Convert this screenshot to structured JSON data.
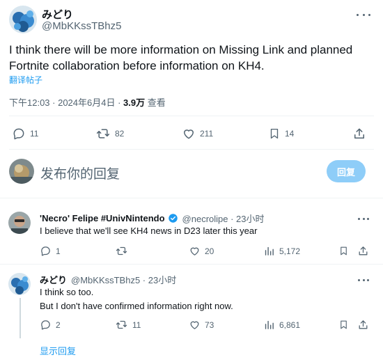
{
  "main_post": {
    "author_name": "みどり",
    "author_handle": "@MbKKssTBhz5",
    "text": "I think there will be more information on Missing Link and planned Fortnite collaboration before information on KH4.",
    "translate_label": "翻译帖子",
    "timestamp": "下午12:03 · 2024年6月4日 · ",
    "views_count": "3.9万",
    "views_label": " 查看",
    "stats": {
      "replies": "11",
      "reposts": "82",
      "likes": "211",
      "bookmarks": "14"
    }
  },
  "composer": {
    "placeholder": "发布你的回复",
    "reply_button": "回复"
  },
  "replies": [
    {
      "author_name": "'Necro' Felipe #UnivNintendo",
      "author_handle": "@necrolipe · 23小时",
      "text_lines": [
        "I believe that we'll see KH4 news in D23 later this year"
      ],
      "stats": {
        "replies": "1",
        "reposts": "",
        "likes": "20",
        "views": "5,172"
      }
    },
    {
      "author_name": "みどり",
      "author_handle": "@MbKKssTBhz5 · 23小时",
      "text_lines": [
        "I think so too.",
        "But I don't have confirmed information right now."
      ],
      "stats": {
        "replies": "2",
        "reposts": "11",
        "likes": "73",
        "views": "6,861"
      }
    }
  ],
  "show_replies_label": "显示回复",
  "colors": {
    "accent": "#1d9bf0",
    "reply_button_disabled": "#8ecdf8",
    "muted_text": "#536471",
    "verified_badge": "#1d9bf0"
  },
  "icons": {
    "reply": "reply-icon",
    "repost": "repost-icon",
    "like": "heart-icon",
    "bookmark": "bookmark-icon",
    "share": "share-icon",
    "views": "views-icon",
    "more": "more-icon",
    "verified": "verified-badge-icon"
  }
}
